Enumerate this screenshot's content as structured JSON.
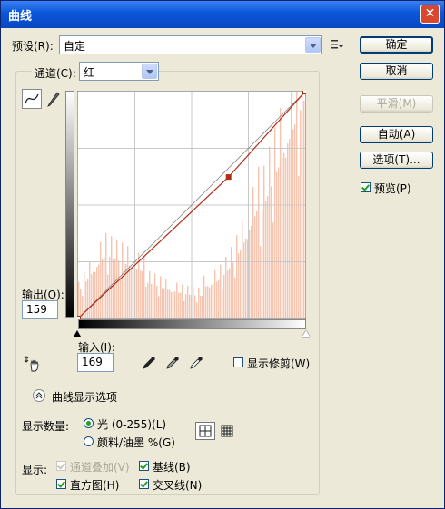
{
  "window": {
    "title": "曲线"
  },
  "preset": {
    "label": "预设(R):",
    "value": "自定"
  },
  "channel": {
    "label": "通道(C):",
    "value": "红"
  },
  "buttons": {
    "ok": "确定",
    "cancel": "取消",
    "smooth": "平滑(M)",
    "auto": "自动(A)",
    "options": "选项(T)..."
  },
  "preview": {
    "label": "预览(P)",
    "checked": true
  },
  "output": {
    "label": "输出(O):",
    "value": "159"
  },
  "input": {
    "label": "输入(I):",
    "value": "169"
  },
  "show_clipping": {
    "label": "显示修剪(W)",
    "checked": false
  },
  "curve_options": {
    "label": "曲线显示选项"
  },
  "show_amount": {
    "label": "显示数量:",
    "options": [
      {
        "label": "光 (0-255)(L)",
        "selected": true
      },
      {
        "label": "颜料/油墨 %(G)",
        "selected": false
      }
    ]
  },
  "show": {
    "label": "显示:",
    "items": [
      {
        "label": "通道叠加(V)",
        "checked": true,
        "disabled": true
      },
      {
        "label": "基线(B)",
        "checked": true,
        "disabled": false
      },
      {
        "label": "直方图(H)",
        "checked": true,
        "disabled": false
      },
      {
        "label": "交叉线(N)",
        "checked": true,
        "disabled": false
      }
    ]
  },
  "curve": {
    "points": [
      {
        "input": 0,
        "output": 0
      },
      {
        "input": 169,
        "output": 159
      },
      {
        "input": 255,
        "output": 255
      }
    ],
    "histogram_color": "#f7c4b0",
    "curve_color": "#b42a14"
  },
  "colors": {
    "title_bar": "#0a56d8",
    "dialog_bg": "#ece9d8"
  }
}
